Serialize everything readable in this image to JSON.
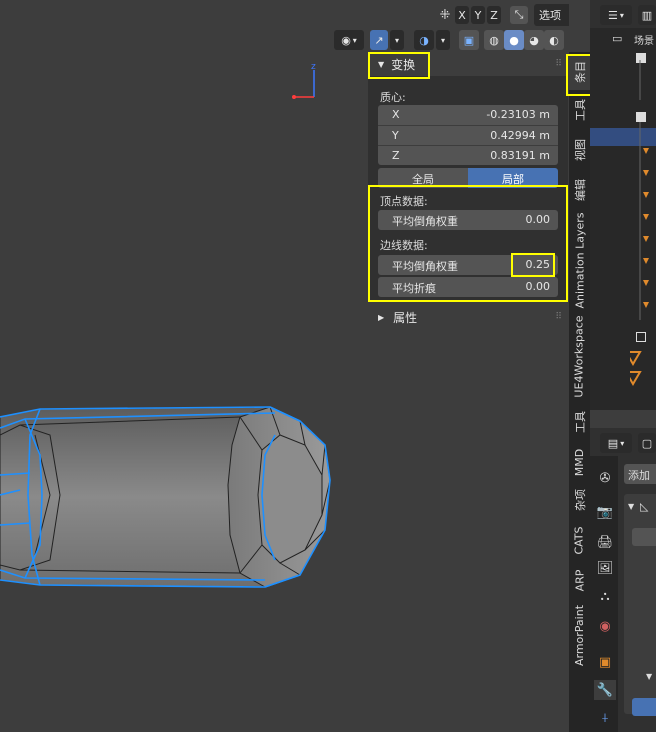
{
  "header": {
    "mirror_axes": [
      "X",
      "Y",
      "Z"
    ],
    "options_label": "选项",
    "options_caret": "⌄"
  },
  "viewport": {
    "gizmo": {
      "z": "z"
    }
  },
  "npanel": {
    "transform": {
      "title": "变换",
      "median_label": "质心:",
      "coords": [
        {
          "axis": "X",
          "value": "-0.23103 m"
        },
        {
          "axis": "Y",
          "value": "0.42994 m"
        },
        {
          "axis": "Z",
          "value": "0.83191 m"
        }
      ],
      "space_global": "全局",
      "space_local": "局部",
      "vertex_data_label": "顶点数据:",
      "vertex_bevel_weight_label": "平均倒角权重",
      "vertex_bevel_weight_value": "0.00",
      "edge_data_label": "边线数据:",
      "edge_bevel_weight_label": "平均倒角权重",
      "edge_bevel_weight_value": "0.25",
      "edge_crease_label": "平均折痕",
      "edge_crease_value": "0.00"
    },
    "attributes": {
      "title": "属性"
    }
  },
  "tabs": [
    "条目",
    "工具",
    "视图",
    "编辑",
    "Animation Layers",
    "UE4Workspace",
    "工具",
    "MMD",
    "杂项",
    "CATS",
    "ARP",
    "ArmorPaint"
  ],
  "outliner": {
    "scene_label": "场景"
  },
  "properties": {
    "add_label": "添加"
  },
  "colors": {
    "highlight": "#ffff00",
    "selected_blue": "#4772b3",
    "wire_blue": "#1e90ff",
    "orange": "#e08a2c"
  }
}
